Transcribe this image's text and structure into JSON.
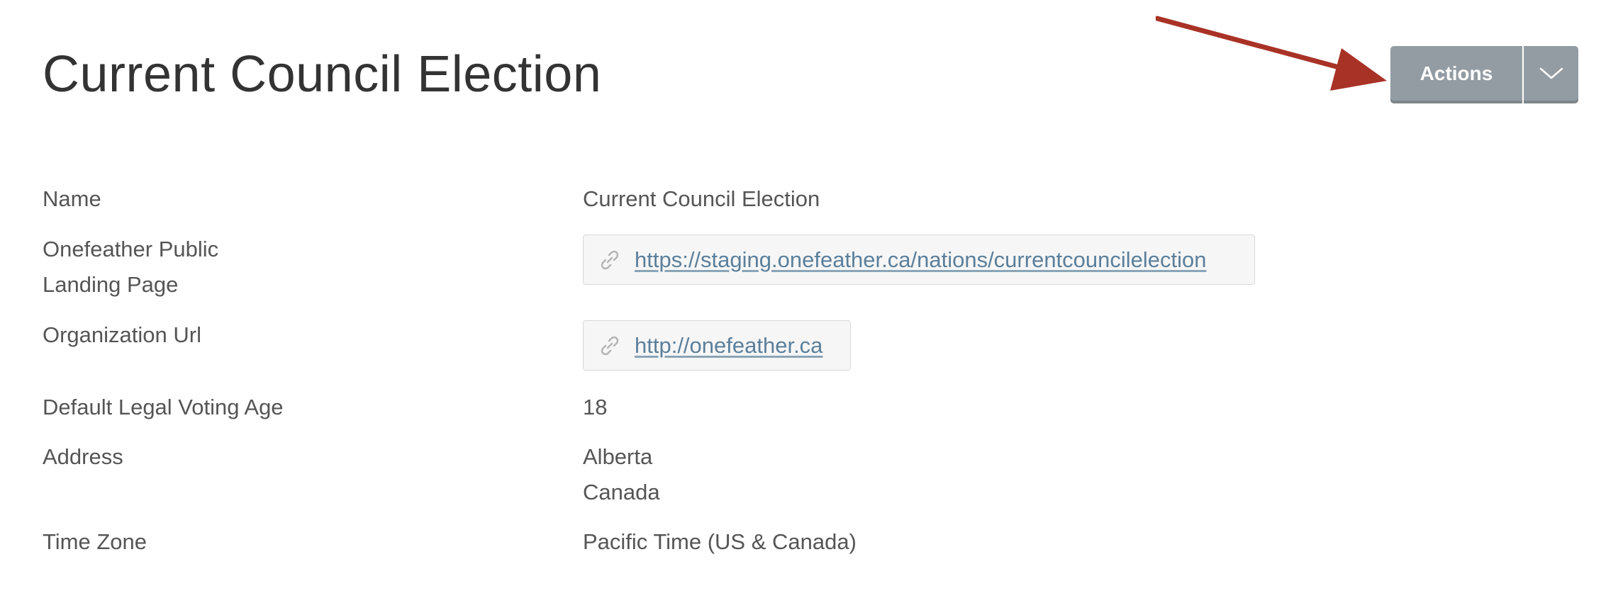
{
  "header": {
    "title": "Current Council Election",
    "actions_label": "Actions",
    "actions_toggle_icon": "chevron-down-icon",
    "annotation_arrow_color": "#a93226"
  },
  "details": {
    "name": {
      "label": "Name",
      "value": "Current Council Election"
    },
    "landing_page": {
      "label_line1": "Onefeather Public",
      "label_line2": "Landing Page",
      "url": "https://staging.onefeather.ca/nations/currentcouncilelection",
      "icon": "link-icon"
    },
    "organization_url": {
      "label": "Organization Url",
      "url": "http://onefeather.ca",
      "icon": "link-icon"
    },
    "voting_age": {
      "label": "Default Legal Voting Age",
      "value": "18"
    },
    "address": {
      "label": "Address",
      "line1": "Alberta",
      "line2": "Canada"
    },
    "time_zone": {
      "label": "Time Zone",
      "value": "Pacific Time (US & Canada)"
    }
  },
  "colors": {
    "button_bg": "#939ca3",
    "link": "#5b7f9b",
    "text": "#555555",
    "title": "#333333"
  }
}
